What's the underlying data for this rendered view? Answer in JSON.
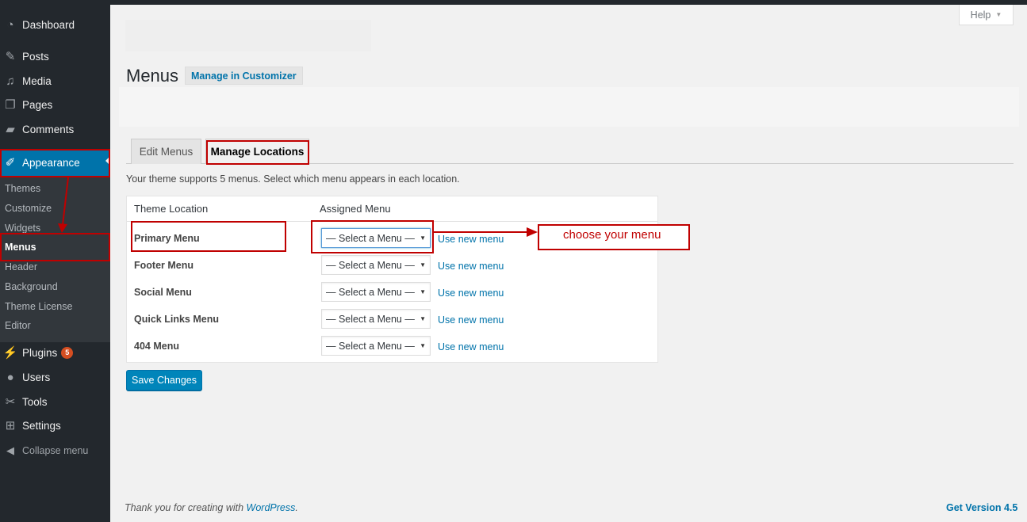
{
  "sidebar": {
    "items": [
      {
        "label": "Dashboard",
        "icon": "dashboard-icon"
      },
      {
        "label": "Posts",
        "icon": "pin-icon"
      },
      {
        "label": "Media",
        "icon": "media-icon"
      },
      {
        "label": "Pages",
        "icon": "pages-icon"
      },
      {
        "label": "Comments",
        "icon": "comment-icon"
      },
      {
        "label": "Appearance",
        "icon": "brush-icon"
      },
      {
        "label": "Plugins",
        "icon": "plugin-icon",
        "badge": "5"
      },
      {
        "label": "Users",
        "icon": "user-icon"
      },
      {
        "label": "Tools",
        "icon": "wrench-icon"
      },
      {
        "label": "Settings",
        "icon": "settings-icon"
      }
    ],
    "submenu": [
      "Themes",
      "Customize",
      "Widgets",
      "Menus",
      "Header",
      "Background",
      "Theme License",
      "Editor"
    ],
    "collapse_label": "Collapse menu"
  },
  "header": {
    "help_label": "Help",
    "page_title": "Menus",
    "title_action": "Manage in Customizer"
  },
  "tabs": [
    "Edit Menus",
    "Manage Locations"
  ],
  "intro_text": "Your theme supports 5 menus. Select which menu appears in each location.",
  "locations_table": {
    "headers": [
      "Theme Location",
      "Assigned Menu"
    ],
    "rows": [
      {
        "location": "Primary Menu",
        "selected": "— Select a Menu —",
        "link": "Use new menu"
      },
      {
        "location": "Footer Menu",
        "selected": "— Select a Menu —",
        "link": "Use new menu"
      },
      {
        "location": "Social Menu",
        "selected": "— Select a Menu —",
        "link": "Use new menu"
      },
      {
        "location": "Quick Links Menu",
        "selected": "— Select a Menu —",
        "link": "Use new menu"
      },
      {
        "location": "404 Menu",
        "selected": "— Select a Menu —",
        "link": "Use new menu"
      }
    ]
  },
  "save_label": "Save Changes",
  "footer": {
    "thanks_prefix": "Thank you for creating with ",
    "wp_link": "WordPress",
    "thanks_suffix": ".",
    "version_link": "Get Version 4.5"
  },
  "annotation": {
    "label": "choose your menu",
    "color": "#c00000"
  },
  "colors": {
    "sidebar_bg": "#23282d",
    "accent": "#0073aa",
    "button": "#0085ba",
    "badge": "#d54e21"
  }
}
